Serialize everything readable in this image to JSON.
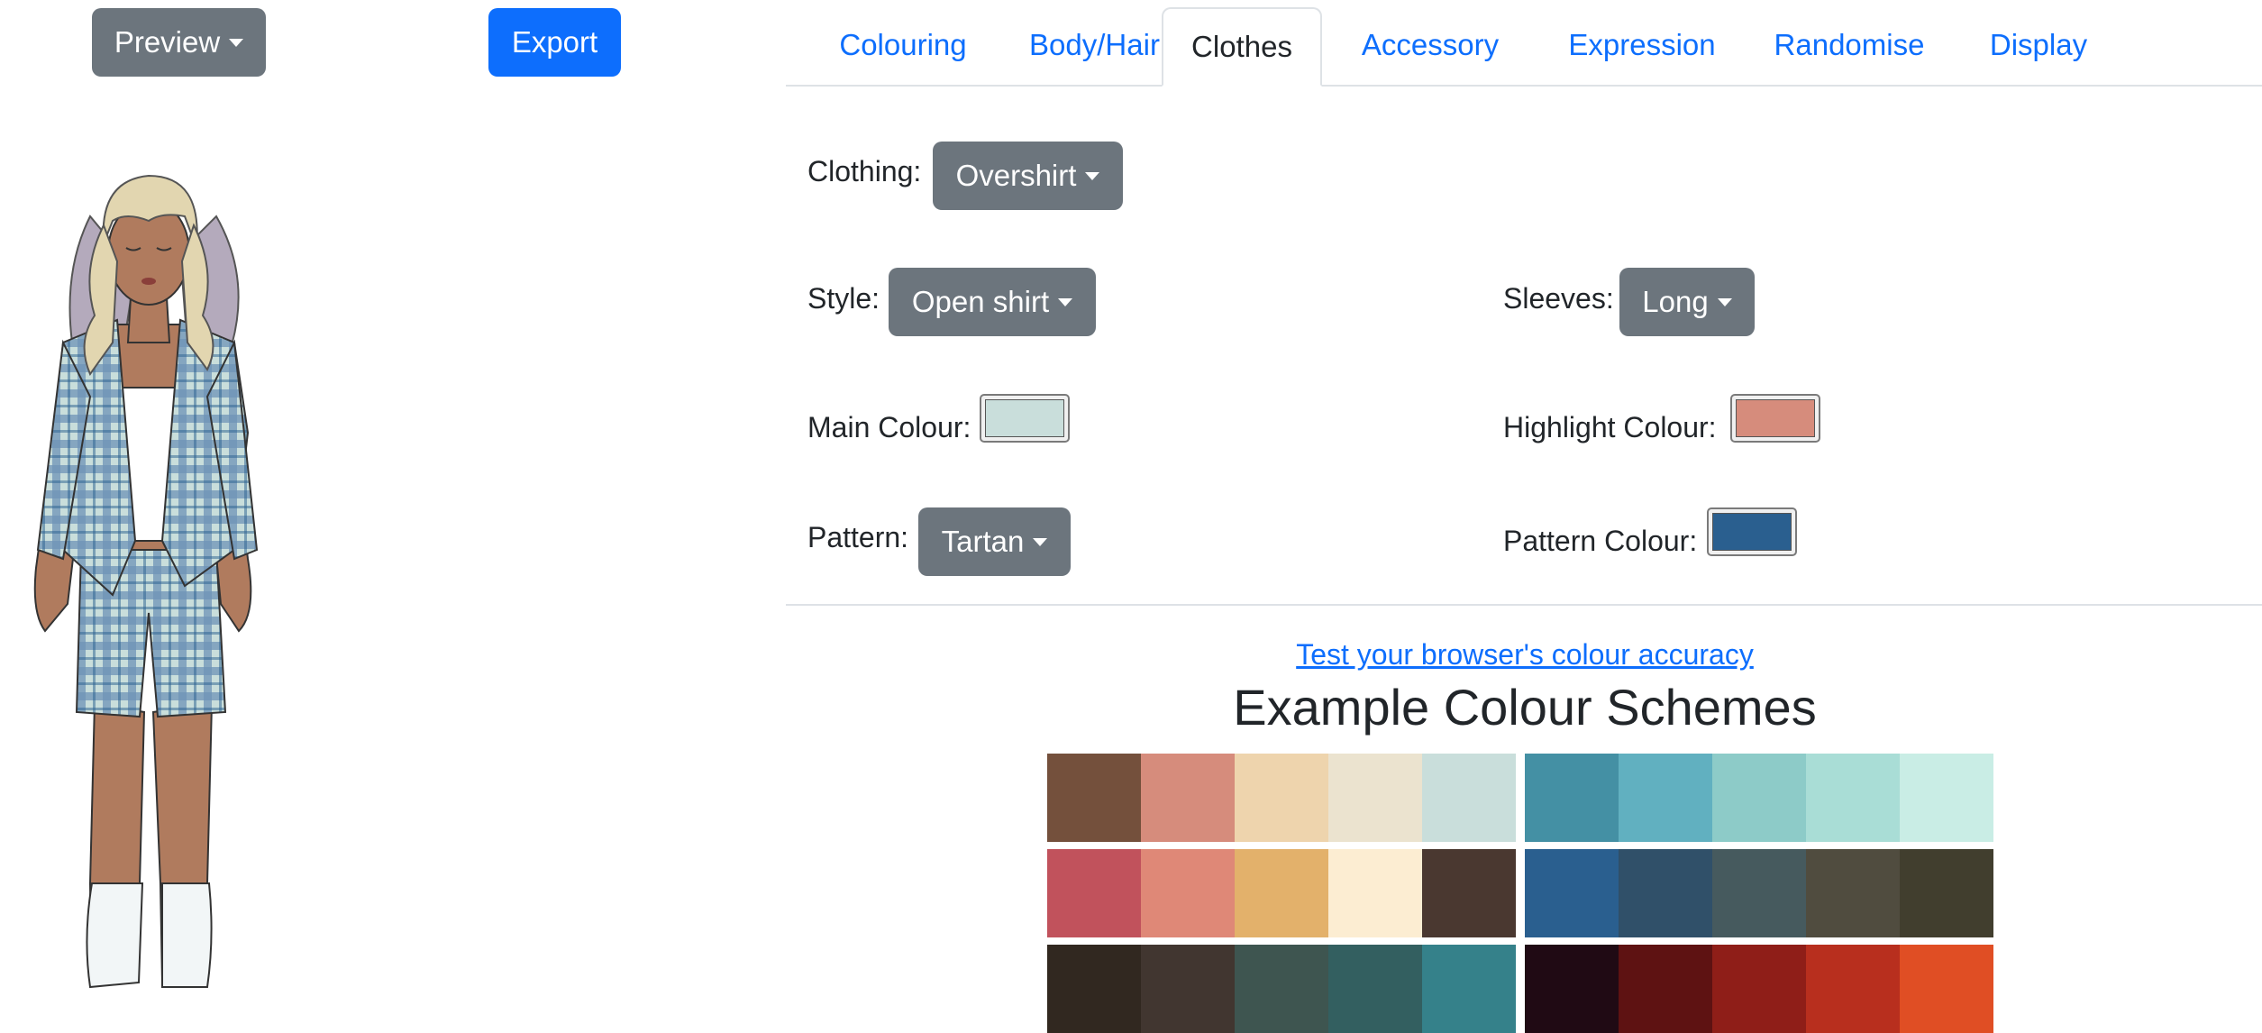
{
  "toolbar": {
    "preview_label": "Preview",
    "export_label": "Export"
  },
  "tabs": [
    {
      "label": "Colouring",
      "active": false
    },
    {
      "label": "Body/Hair",
      "active": false
    },
    {
      "label": "Clothes",
      "active": true
    },
    {
      "label": "Accessory",
      "active": false
    },
    {
      "label": "Expression",
      "active": false
    },
    {
      "label": "Randomise",
      "active": false
    },
    {
      "label": "Display",
      "active": false
    }
  ],
  "clothes": {
    "clothing": {
      "label": "Clothing:",
      "value": "Overshirt"
    },
    "style": {
      "label": "Style:",
      "value": "Open shirt"
    },
    "sleeves": {
      "label": "Sleeves:",
      "value": "Long"
    },
    "main_colour": {
      "label": "Main Colour:",
      "color": "#c9dedb"
    },
    "highlight_colour": {
      "label": "Highlight Colour:",
      "color": "#d68c7c"
    },
    "pattern": {
      "label": "Pattern:",
      "value": "Tartan"
    },
    "pattern_colour": {
      "label": "Pattern Colour:",
      "color": "#2a5f8f"
    }
  },
  "colour_accuracy_link": "Test your browser's colour accuracy",
  "schemes_heading": "Example Colour Schemes",
  "colour_schemes": [
    {
      "colors": [
        "#74503c",
        "#d68c7c",
        "#eed4ad",
        "#ebe3cf",
        "#c9dedb"
      ]
    },
    {
      "colors": [
        "#4490a4",
        "#61b0c0",
        "#8dcbc8",
        "#a9ddd6",
        "#c9ede5"
      ]
    },
    {
      "colors": [
        "#c1525c",
        "#df8877",
        "#e3b16b",
        "#fcedd2",
        "#4a3830"
      ]
    },
    {
      "colors": [
        "#2a5f8f",
        "#305069",
        "#465a5e",
        "#504c3f",
        "#413e2e"
      ]
    },
    {
      "colors": [
        "#312820",
        "#413630",
        "#3e5550",
        "#335f60",
        "#35818a"
      ]
    },
    {
      "colors": [
        "#200a14",
        "#5e1212",
        "#8f1e18",
        "#b82f1e",
        "#e04e24"
      ]
    }
  ],
  "character_preview": {
    "hair": "#e2d6b0",
    "hair_shadow": "#b4aabc",
    "skin": "#b07b5e",
    "top": "#ffffff",
    "shirt": "#c9dedb",
    "pattern": "#6f93b7",
    "socks": "#f2f6f7"
  }
}
